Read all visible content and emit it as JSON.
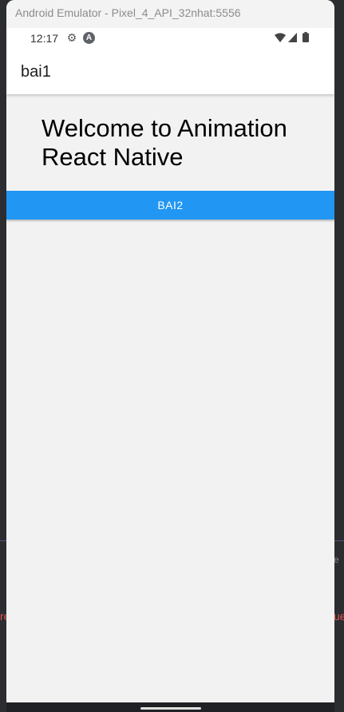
{
  "window": {
    "title": "Android Emulator - Pixel_4_API_32nhat:5556"
  },
  "status_bar": {
    "time": "12:17",
    "icons": [
      "gear-icon",
      "android-a-icon",
      "wifi-icon",
      "cellular-signal-icon",
      "battery-icon"
    ],
    "a_glyph": "A",
    "gear_glyph": "⚙"
  },
  "app_bar": {
    "title": "bai1"
  },
  "content": {
    "welcome_text": "Welcome to Animation React Native",
    "button_label": "BAI2"
  },
  "background_fragments": {
    "left": "re",
    "right": "ue",
    "right_dot": "e"
  },
  "colors": {
    "accent": "#2196f3",
    "screen_background": "#f2f2f2",
    "app_bar": "#ffffff",
    "backdrop": "#2b2d31",
    "backdrop_error_text": "#e0534d"
  }
}
